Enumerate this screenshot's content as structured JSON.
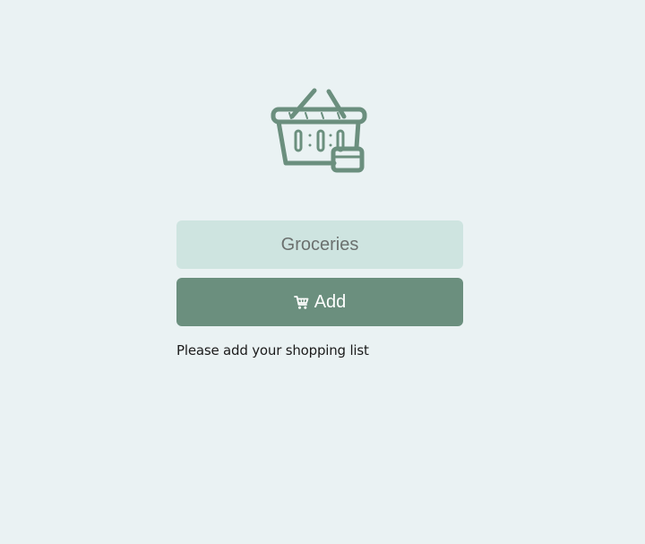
{
  "logo": {
    "icon": "basket-icon",
    "color": "#6b8f7e"
  },
  "form": {
    "input": {
      "value": "",
      "placeholder": "Groceries"
    },
    "add_button": {
      "icon": "cart-icon",
      "label": "Add"
    }
  },
  "status": {
    "message": "Please add your shopping list"
  },
  "colors": {
    "background": "#eaf2f3",
    "input_bg": "#cee4e0",
    "accent": "#6b8f7e"
  }
}
